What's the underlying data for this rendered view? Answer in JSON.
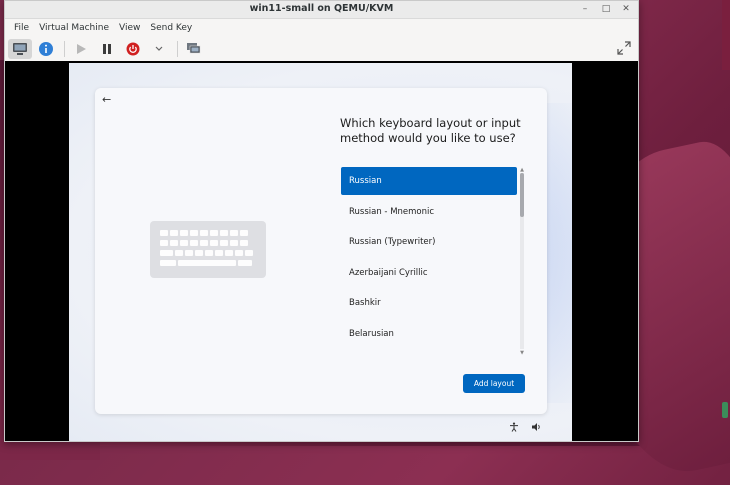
{
  "window": {
    "title": "win11-small on QEMU/KVM",
    "controls": {
      "minimize": "–",
      "maximize": "□",
      "close": "✕"
    }
  },
  "menubar": [
    "File",
    "Virtual Machine",
    "View",
    "Send Key"
  ],
  "toolbar": {
    "buttons": [
      "console-icon",
      "details-icon",
      "run-icon",
      "pause-icon",
      "shutdown-icon",
      "dropdown-chevron-icon",
      "snapshots-icon"
    ],
    "fullscreen_icon": "fullscreen-icon"
  },
  "setup": {
    "heading": "Which keyboard layout or input method would you like to use?",
    "back_glyph": "←",
    "layouts": [
      {
        "label": "Russian",
        "selected": true
      },
      {
        "label": "Russian - Mnemonic",
        "selected": false
      },
      {
        "label": "Russian (Typewriter)",
        "selected": false
      },
      {
        "label": "Azerbaijani Cyrillic",
        "selected": false
      },
      {
        "label": "Bashkir",
        "selected": false
      },
      {
        "label": "Belarusian",
        "selected": false
      }
    ],
    "add_layout_label": "Add layout",
    "scroll_position": 0.0
  },
  "system_icons": [
    "accessibility-icon",
    "volume-icon"
  ],
  "colors": {
    "accent": "#0067c0",
    "desktop": "#7a2a4a"
  }
}
